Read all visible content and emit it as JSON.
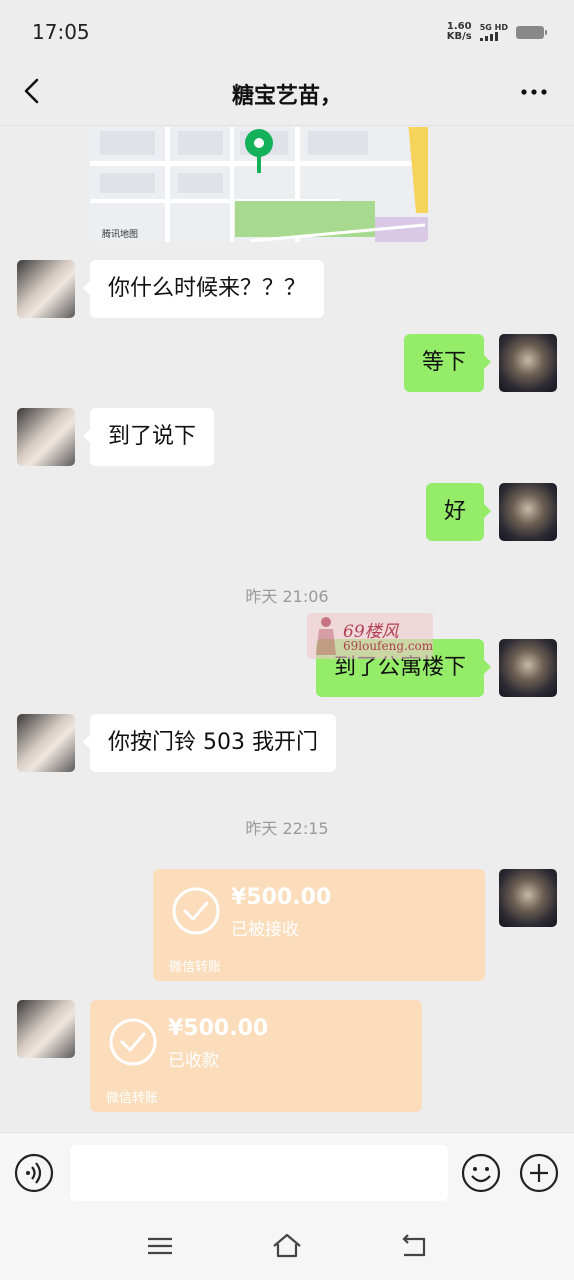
{
  "status_bar": {
    "time": "17:05",
    "speed_value": "1.60",
    "speed_unit": "KB/s",
    "network": "5G HD",
    "icons": [
      "signal-icon",
      "battery-icon"
    ]
  },
  "header": {
    "title": "糖宝艺苗，",
    "back_icon": "chevron-left-icon",
    "more_icon": "more-dots-icon"
  },
  "map": {
    "credit": "腾讯地图",
    "icon": "location-pin-icon"
  },
  "messages": [
    {
      "side": "left",
      "text": "你什么时候来？？？"
    },
    {
      "side": "right",
      "text": "等下"
    },
    {
      "side": "left",
      "text": "到了说下"
    },
    {
      "side": "right",
      "text": "好"
    },
    {
      "side": "right",
      "text": "到了公寓楼下"
    },
    {
      "side": "left",
      "text": "你按门铃 503 我开门"
    }
  ],
  "timestamps": [
    "昨天 21:06",
    "昨天 22:15"
  ],
  "watermark": {
    "cn": "69楼风",
    "url": "69loufeng.com"
  },
  "transfers": [
    {
      "side": "right",
      "amount": "¥500.00",
      "status": "已被接收",
      "source": "微信转账"
    },
    {
      "side": "left",
      "amount": "¥500.00",
      "status": "已收款",
      "source": "微信转账"
    }
  ],
  "colors": {
    "background": "#ededed",
    "bubble_sent": "#95ec69",
    "bubble_received": "#ffffff",
    "transfer_card": "#fbdcbb",
    "timestamp": "#9a9a9a"
  },
  "input_bar": {
    "icons": [
      "voice-icon",
      "emoji-icon",
      "plus-icon"
    ]
  },
  "nav_bar": {
    "icons": [
      "menu-icon",
      "home-icon",
      "back-icon"
    ]
  }
}
